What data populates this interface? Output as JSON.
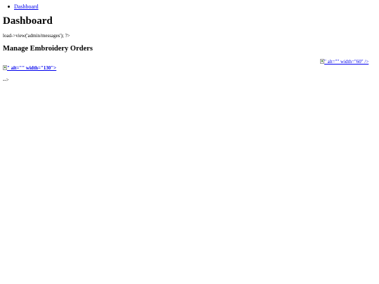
{
  "breadcrumb": {
    "items": [
      {
        "label": "Dashboard"
      }
    ]
  },
  "header": {
    "title": "Dashboard"
  },
  "raw_code": {
    "line": "load->view('admin/messages'); ?>"
  },
  "section": {
    "title": "Manage Embroidery Orders"
  },
  "images": {
    "right_link_text": "\" alt=\"\" width=\"60\" />",
    "left_link_text": "\" alt=\"\" width=\"130\">"
  },
  "footer_raw": {
    "text": "-->"
  }
}
